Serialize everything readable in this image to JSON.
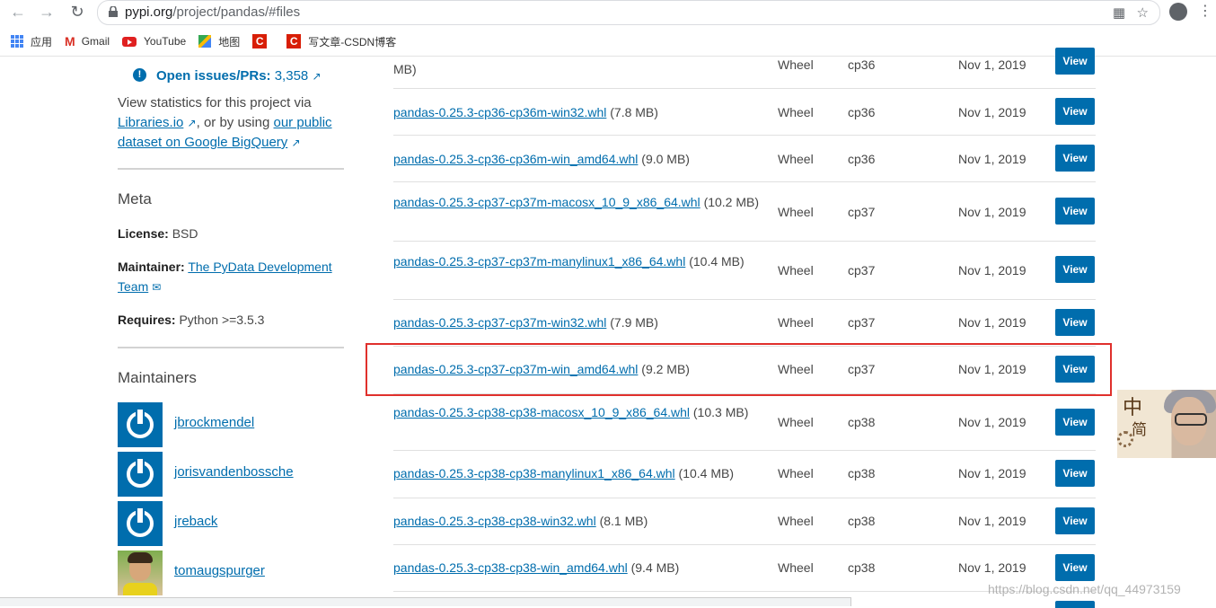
{
  "browser": {
    "url_host": "pypi.org",
    "url_path": "/project/pandas/#files",
    "bookmarks": [
      {
        "label": "应用",
        "icon": "apps-grid-icon"
      },
      {
        "label": "Gmail",
        "icon": "gmail-icon"
      },
      {
        "label": "YouTube",
        "icon": "youtube-icon"
      },
      {
        "label": "地图",
        "icon": "maps-icon"
      },
      {
        "label": "",
        "icon": "csdn-icon"
      },
      {
        "label": "写文章-CSDN博客",
        "icon": "csdn-icon"
      }
    ]
  },
  "sidebar": {
    "open_issues_label": "Open issues/PRs:",
    "open_issues_count": "3,358",
    "stats_text_1": "View statistics for this project via",
    "stats_link_1": "Libraries.io",
    "stats_text_2": ", or by using",
    "stats_link_2": "our public dataset on Google BigQuery",
    "meta_title": "Meta",
    "license_label": "License:",
    "license_value": "BSD",
    "maintainer_label": "Maintainer:",
    "maintainer_value": "The PyData Development Team",
    "requires_label": "Requires:",
    "requires_value": "Python >=3.5.3",
    "maintainers_title": "Maintainers",
    "maintainers": [
      "jbrockmendel",
      "jorisvandenbossche",
      "jreback",
      "tomaugspurger"
    ]
  },
  "files": {
    "view_label": "View",
    "rows": [
      {
        "name": "",
        "size": "MB)",
        "type": "Wheel",
        "python": "cp36",
        "date": "Nov 1, 2019"
      },
      {
        "name": "pandas-0.25.3-cp36-cp36m-win32.whl",
        "size": "(7.8 MB)",
        "type": "Wheel",
        "python": "cp36",
        "date": "Nov 1, 2019"
      },
      {
        "name": "pandas-0.25.3-cp36-cp36m-win_amd64.whl",
        "size": "(9.0 MB)",
        "type": "Wheel",
        "python": "cp36",
        "date": "Nov 1, 2019"
      },
      {
        "name": "pandas-0.25.3-cp37-cp37m-macosx_10_9_x86_64.whl",
        "size": "(10.2 MB)",
        "type": "Wheel",
        "python": "cp37",
        "date": "Nov 1, 2019"
      },
      {
        "name": "pandas-0.25.3-cp37-cp37m-manylinux1_x86_64.whl",
        "size": "(10.4 MB)",
        "type": "Wheel",
        "python": "cp37",
        "date": "Nov 1, 2019"
      },
      {
        "name": "pandas-0.25.3-cp37-cp37m-win32.whl",
        "size": "(7.9 MB)",
        "type": "Wheel",
        "python": "cp37",
        "date": "Nov 1, 2019"
      },
      {
        "name": "pandas-0.25.3-cp37-cp37m-win_amd64.whl",
        "size": "(9.2 MB)",
        "type": "Wheel",
        "python": "cp37",
        "date": "Nov 1, 2019"
      },
      {
        "name": "pandas-0.25.3-cp38-cp38-macosx_10_9_x86_64.whl",
        "size": "(10.3 MB)",
        "type": "Wheel",
        "python": "cp38",
        "date": "Nov 1, 2019"
      },
      {
        "name": "pandas-0.25.3-cp38-cp38-manylinux1_x86_64.whl",
        "size": "(10.4 MB)",
        "type": "Wheel",
        "python": "cp38",
        "date": "Nov 1, 2019"
      },
      {
        "name": "pandas-0.25.3-cp38-cp38-win32.whl",
        "size": "(8.1 MB)",
        "type": "Wheel",
        "python": "cp38",
        "date": "Nov 1, 2019"
      },
      {
        "name": "pandas-0.25.3-cp38-cp38-win_amd64.whl",
        "size": "(9.4 MB)",
        "type": "Wheel",
        "python": "cp38",
        "date": "Nov 1, 2019"
      }
    ]
  },
  "overlay": {
    "ime_zh": "中",
    "ime_jian": "简",
    "watermark": "https://blog.csdn.net/qq_44973159"
  }
}
